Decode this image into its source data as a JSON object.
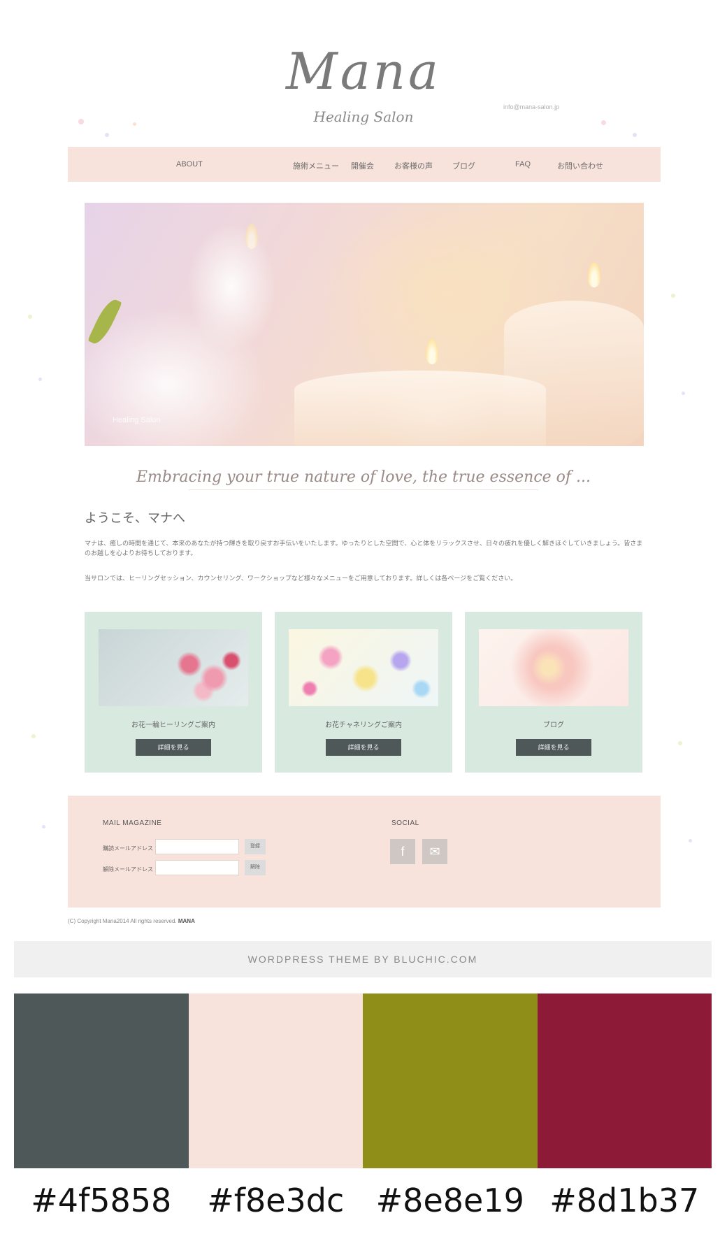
{
  "site": {
    "logo": "Mana",
    "tagline": "Healing Salon",
    "top_contact": "info@mana-salon.jp",
    "nav": [
      "ABOUT",
      "施術メニュー",
      "開催会",
      "お客様の声",
      "ブログ",
      "FAQ",
      "お問い合わせ"
    ],
    "hero_caption": "Healing Salon",
    "script_line": "Embracing your true nature of love, the true essence of ...",
    "welcome_title": "ようこそ、マナへ",
    "intro_paragraphs": [
      "マナは、癒しの時間を通じて、本来のあなたが持つ輝きを取り戻すお手伝いをいたします。ゆったりとした空間で、心と体をリラックスさせ、日々の疲れを優しく解きほぐしていきましょう。皆さまのお越しを心よりお待ちしております。",
      "当サロンでは、ヒーリングセッション、カウンセリング、ワークショップなど様々なメニューをご用意しております。詳しくは各ページをご覧ください。"
    ],
    "cards": [
      {
        "title": "お花一輪ヒーリングご案内",
        "button": "詳細を見る"
      },
      {
        "title": "お花チャネリングご案内",
        "button": "詳細を見る"
      },
      {
        "title": "ブログ",
        "button": "詳細を見る"
      }
    ],
    "footer": {
      "newsletter_title": "MAIL MAGAZINE",
      "fields": [
        {
          "label": "購読メールアドレス",
          "button": "登録"
        },
        {
          "label": "解除メールアドレス",
          "button": "解除"
        }
      ],
      "social_title": "SOCIAL",
      "social_icons": [
        "facebook-icon",
        "mail-icon"
      ]
    },
    "copyright": "(C) Copyright Mana2014 All rights reserved.",
    "copyright_brand": "MANA",
    "theme_credit": "WORDPRESS THEME BY BLUCHIC.COM"
  },
  "palette": [
    {
      "hex": "#4f5858",
      "label": "#4f5858"
    },
    {
      "hex": "#f8e3dc",
      "label": "#f8e3dc"
    },
    {
      "hex": "#8e8e19",
      "label": "#8e8e19"
    },
    {
      "hex": "#8d1b37",
      "label": "#8d1b37"
    }
  ]
}
